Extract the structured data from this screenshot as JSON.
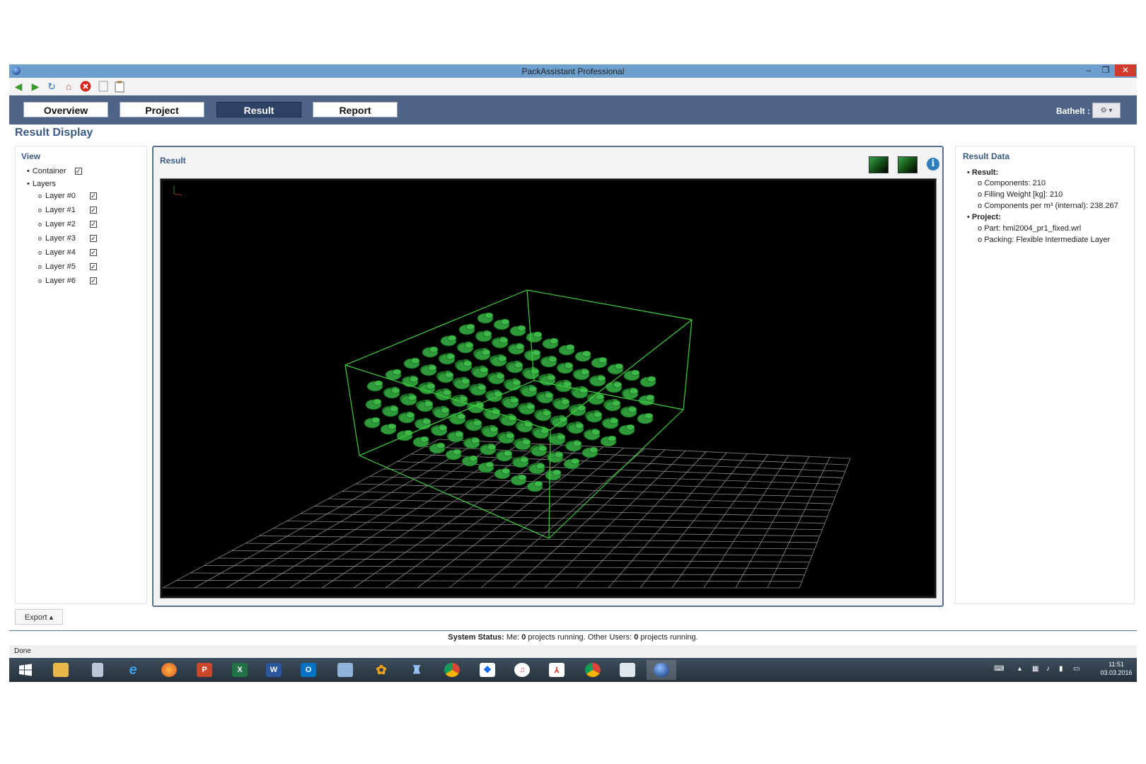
{
  "window": {
    "title": "PackAssistant Professional",
    "controls": {
      "minimize": "–",
      "maximize": "❐",
      "close": "✕"
    }
  },
  "toolbar": {
    "icons": [
      "back-arrow-icon",
      "forward-arrow-icon",
      "refresh-icon",
      "home-icon",
      "stop-icon",
      "copy-icon",
      "clipboard-icon"
    ]
  },
  "nav": {
    "tabs": [
      "Overview",
      "Project",
      "Result",
      "Report"
    ],
    "active": "Result",
    "user_label": "Bathelt :",
    "user_dropdown": "⚙ ▾"
  },
  "page": {
    "title": "Result Display"
  },
  "view_panel": {
    "title": "View",
    "container_label": "Container",
    "layers_label": "Layers",
    "layers": [
      "Layer #0",
      "Layer #1",
      "Layer #2",
      "Layer #3",
      "Layer #4",
      "Layer #5",
      "Layer #6"
    ],
    "check": "✓",
    "bullet": "•",
    "sub_bullet": "o"
  },
  "result_panel": {
    "title": "Result",
    "info": "i",
    "icons": [
      "container-view-icon",
      "layer-view-icon",
      "info-icon"
    ]
  },
  "result_data": {
    "title": "Result Data",
    "result_label": "Result:",
    "components": "Components: 210",
    "filling_weight": "Filling Weight [kg]: 210",
    "components_per_m3": "Components per m³ (internal): 238.267",
    "project_label": "Project:",
    "part": "Part: hmi2004_pr1_fixed.wrl",
    "packing": "Packing: Flexible Intermediate Layer"
  },
  "export": {
    "label": "Export ▴"
  },
  "status": {
    "prefix": "System Status:",
    "me": "Me:",
    "me_count": "0",
    "mid": "projects running.  Other Users:",
    "others_count": "0",
    "suffix": "projects running."
  },
  "done": "Done",
  "taskbar": {
    "apps": [
      "start-icon",
      "file-explorer-icon",
      "calculator-icon",
      "internet-explorer-icon",
      "firefox-icon",
      "powerpoint-icon",
      "excel-icon",
      "word-icon",
      "outlook-icon",
      "project-icon",
      "flower-app-icon",
      "person-app-icon",
      "chrome-icon",
      "dropbox-icon",
      "itunes-icon",
      "acrobat-icon",
      "chrome-icon",
      "window-app-icon",
      "packassistant-icon"
    ],
    "time": "11:51",
    "date": "03.03.2016"
  },
  "colors": {
    "title_bar": "#6f9fcc",
    "nav_bar": "#4d6488",
    "active_tab": "#2e4166",
    "heading": "#3b5b86",
    "viewport_bg": "#000000",
    "part_green": "#2f9a3a",
    "container_edge": "#3bd13b"
  }
}
